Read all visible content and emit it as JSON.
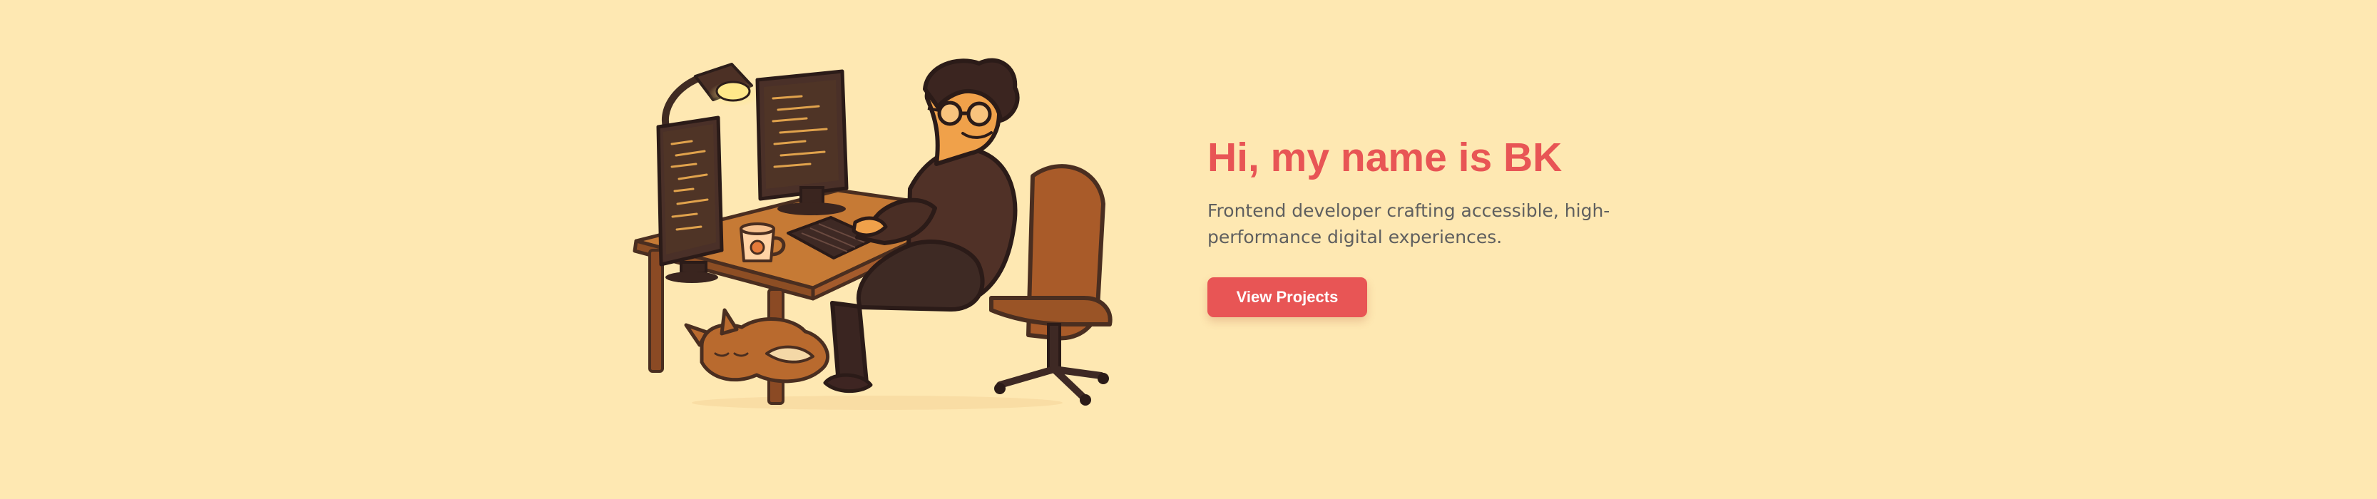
{
  "hero": {
    "heading": "Hi, my name is BK",
    "description": "Frontend developer crafting accessible, high-performance digital experiences.",
    "cta_label": "View Projects"
  },
  "colors": {
    "background": "#FEE8B2",
    "accent": "#E85555",
    "body_text": "#5F5F5F",
    "button_text": "#FFFFFF"
  },
  "illustration": {
    "icon": "developer-at-desk-illustration"
  }
}
